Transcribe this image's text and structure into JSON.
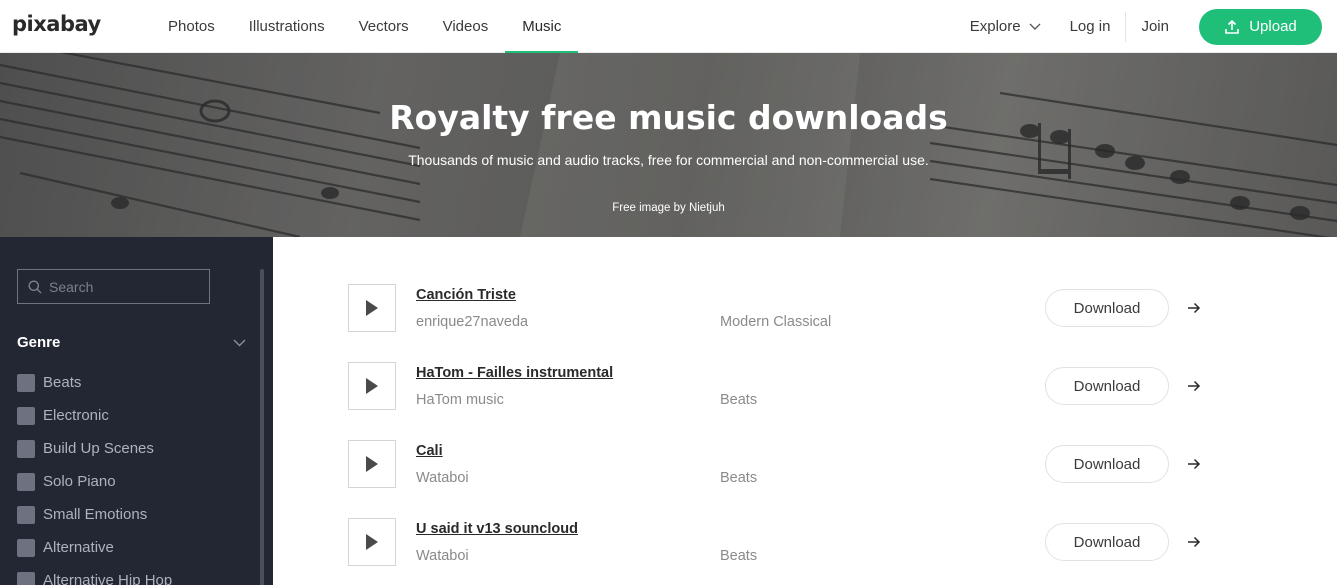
{
  "brand": {
    "logo": "pixabay",
    "accent": "#1fbf7a"
  },
  "nav": {
    "items": [
      "Photos",
      "Illustrations",
      "Vectors",
      "Videos",
      "Music"
    ],
    "active": "Music",
    "explore": "Explore",
    "login": "Log in",
    "join": "Join",
    "upload": "Upload"
  },
  "hero": {
    "title": "Royalty free music downloads",
    "subtitle": "Thousands of music and audio tracks, free for commercial and non-commercial use.",
    "credit": "Free image by Nietjuh"
  },
  "sidebar": {
    "search_placeholder": "Search",
    "genre_heading": "Genre",
    "genres": [
      "Beats",
      "Electronic",
      "Build Up Scenes",
      "Solo Piano",
      "Small Emotions",
      "Alternative",
      "Alternative Hip Hop"
    ]
  },
  "tracks": [
    {
      "title": "Canción Triste",
      "artist": "enrique27naveda",
      "genre": "Modern Classical",
      "download": "Download"
    },
    {
      "title": "HaTom - Failles instrumental",
      "artist": "HaTom music",
      "genre": "Beats",
      "download": "Download"
    },
    {
      "title": "Cali",
      "artist": "Wataboi",
      "genre": "Beats",
      "download": "Download"
    },
    {
      "title": "U said it v13 souncloud",
      "artist": "Wataboi",
      "genre": "Beats",
      "download": "Download"
    }
  ],
  "icons": {
    "explore": "chevron-down-icon",
    "upload": "upload-icon",
    "search": "search-icon",
    "genre_toggle": "chevron-down-icon",
    "play": "play-icon",
    "open": "arrow-right-icon"
  }
}
